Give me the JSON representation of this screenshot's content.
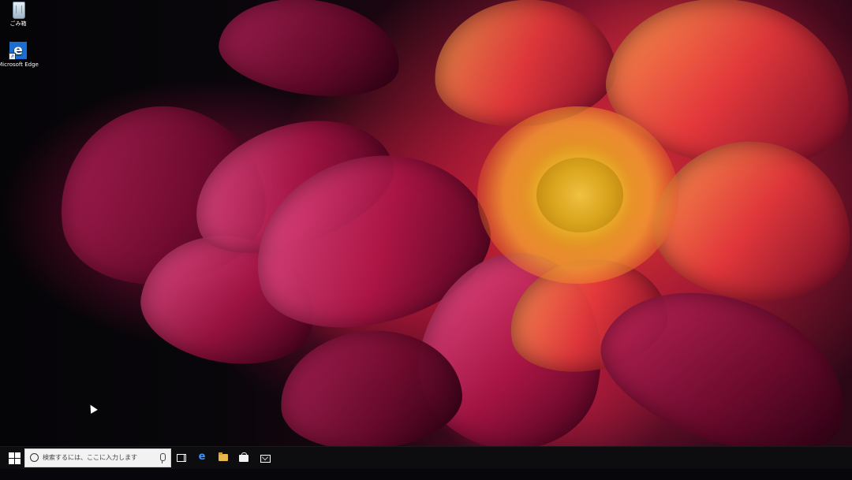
{
  "desktop": {
    "icons": [
      {
        "label": "ごみ箱",
        "icon": "recycle-bin-icon"
      },
      {
        "label": "Microsoft Edge",
        "icon": "edge-icon"
      }
    ]
  },
  "taskbar": {
    "search": {
      "placeholder": "検索するには、ここに入力します"
    },
    "edge_glyph": "e",
    "pinned": [
      "task-view-icon",
      "edge-icon",
      "file-explorer-icon",
      "store-icon",
      "mail-icon"
    ]
  },
  "colors": {
    "taskbar": "#0e0c10",
    "edge_blue": "#1c6fd1",
    "wallpaper_accent": "#d6244f",
    "flower_center": "#e0a020"
  }
}
